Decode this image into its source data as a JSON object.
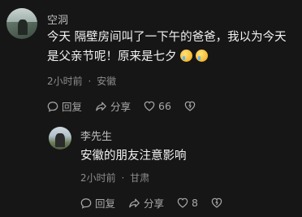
{
  "comment": {
    "author": "空洞",
    "text_line1": "今天 隔壁房间叫了一下午的爸爸，我以为今天",
    "text_line2": "是父亲节呢！原来是七夕",
    "emoji_1": "crying-face",
    "emoji_2": "crying-face",
    "time": "2小时前",
    "location": "安徽",
    "reply_label": "回复",
    "share_label": "分享",
    "like_count": "66"
  },
  "reply": {
    "author": "李先生",
    "text": "安徽的朋友注意影响",
    "time": "2小时前",
    "location": "甘肃",
    "reply_label": "回复",
    "share_label": "分享",
    "like_count": "8"
  },
  "meta_separator": "·"
}
